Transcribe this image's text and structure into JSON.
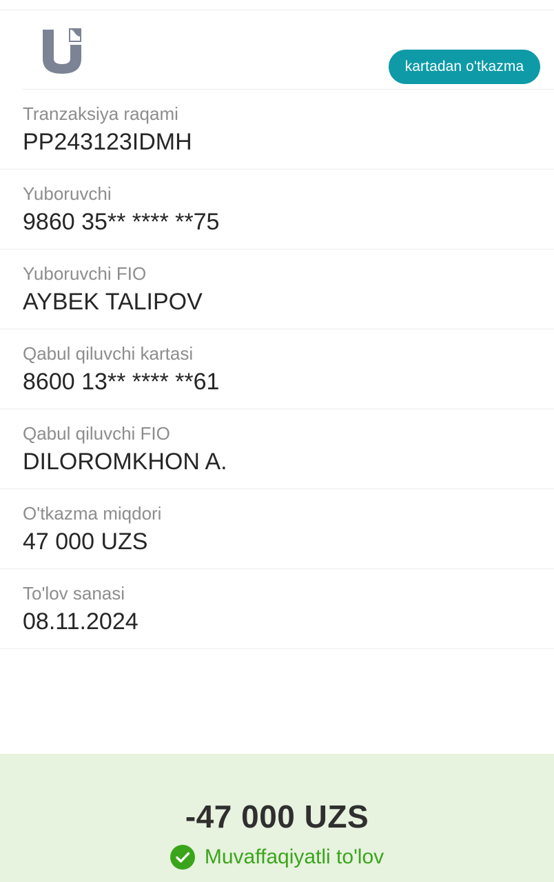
{
  "header": {
    "logo_icon": "uzcard-logo-icon",
    "badge_label": "kartadan o'tkazma",
    "badge_color": "#0e9aa7"
  },
  "details": [
    {
      "label": "Tranzaksiya raqami",
      "value": "PP243123IDMH"
    },
    {
      "label": "Yuboruvchi",
      "value": "9860 35** **** **75"
    },
    {
      "label": "Yuboruvchi FIO",
      "value": "AYBEK TALIPOV"
    },
    {
      "label": "Qabul qiluvchi kartasi",
      "value": "8600 13** **** **61"
    },
    {
      "label": "Qabul qiluvchi FIO",
      "value": "DILOROMKHON A."
    },
    {
      "label": "O'tkazma miqdori",
      "value": "47 000 UZS"
    },
    {
      "label": "To'lov sanasi",
      "value": "08.11.2024"
    }
  ],
  "summary": {
    "amount": "-47 000 UZS",
    "status_text": "Muvaffaqiyatli to'lov",
    "status_icon": "check-circle-icon",
    "status_color": "#3aa51b",
    "background_color": "#e7f2df"
  }
}
